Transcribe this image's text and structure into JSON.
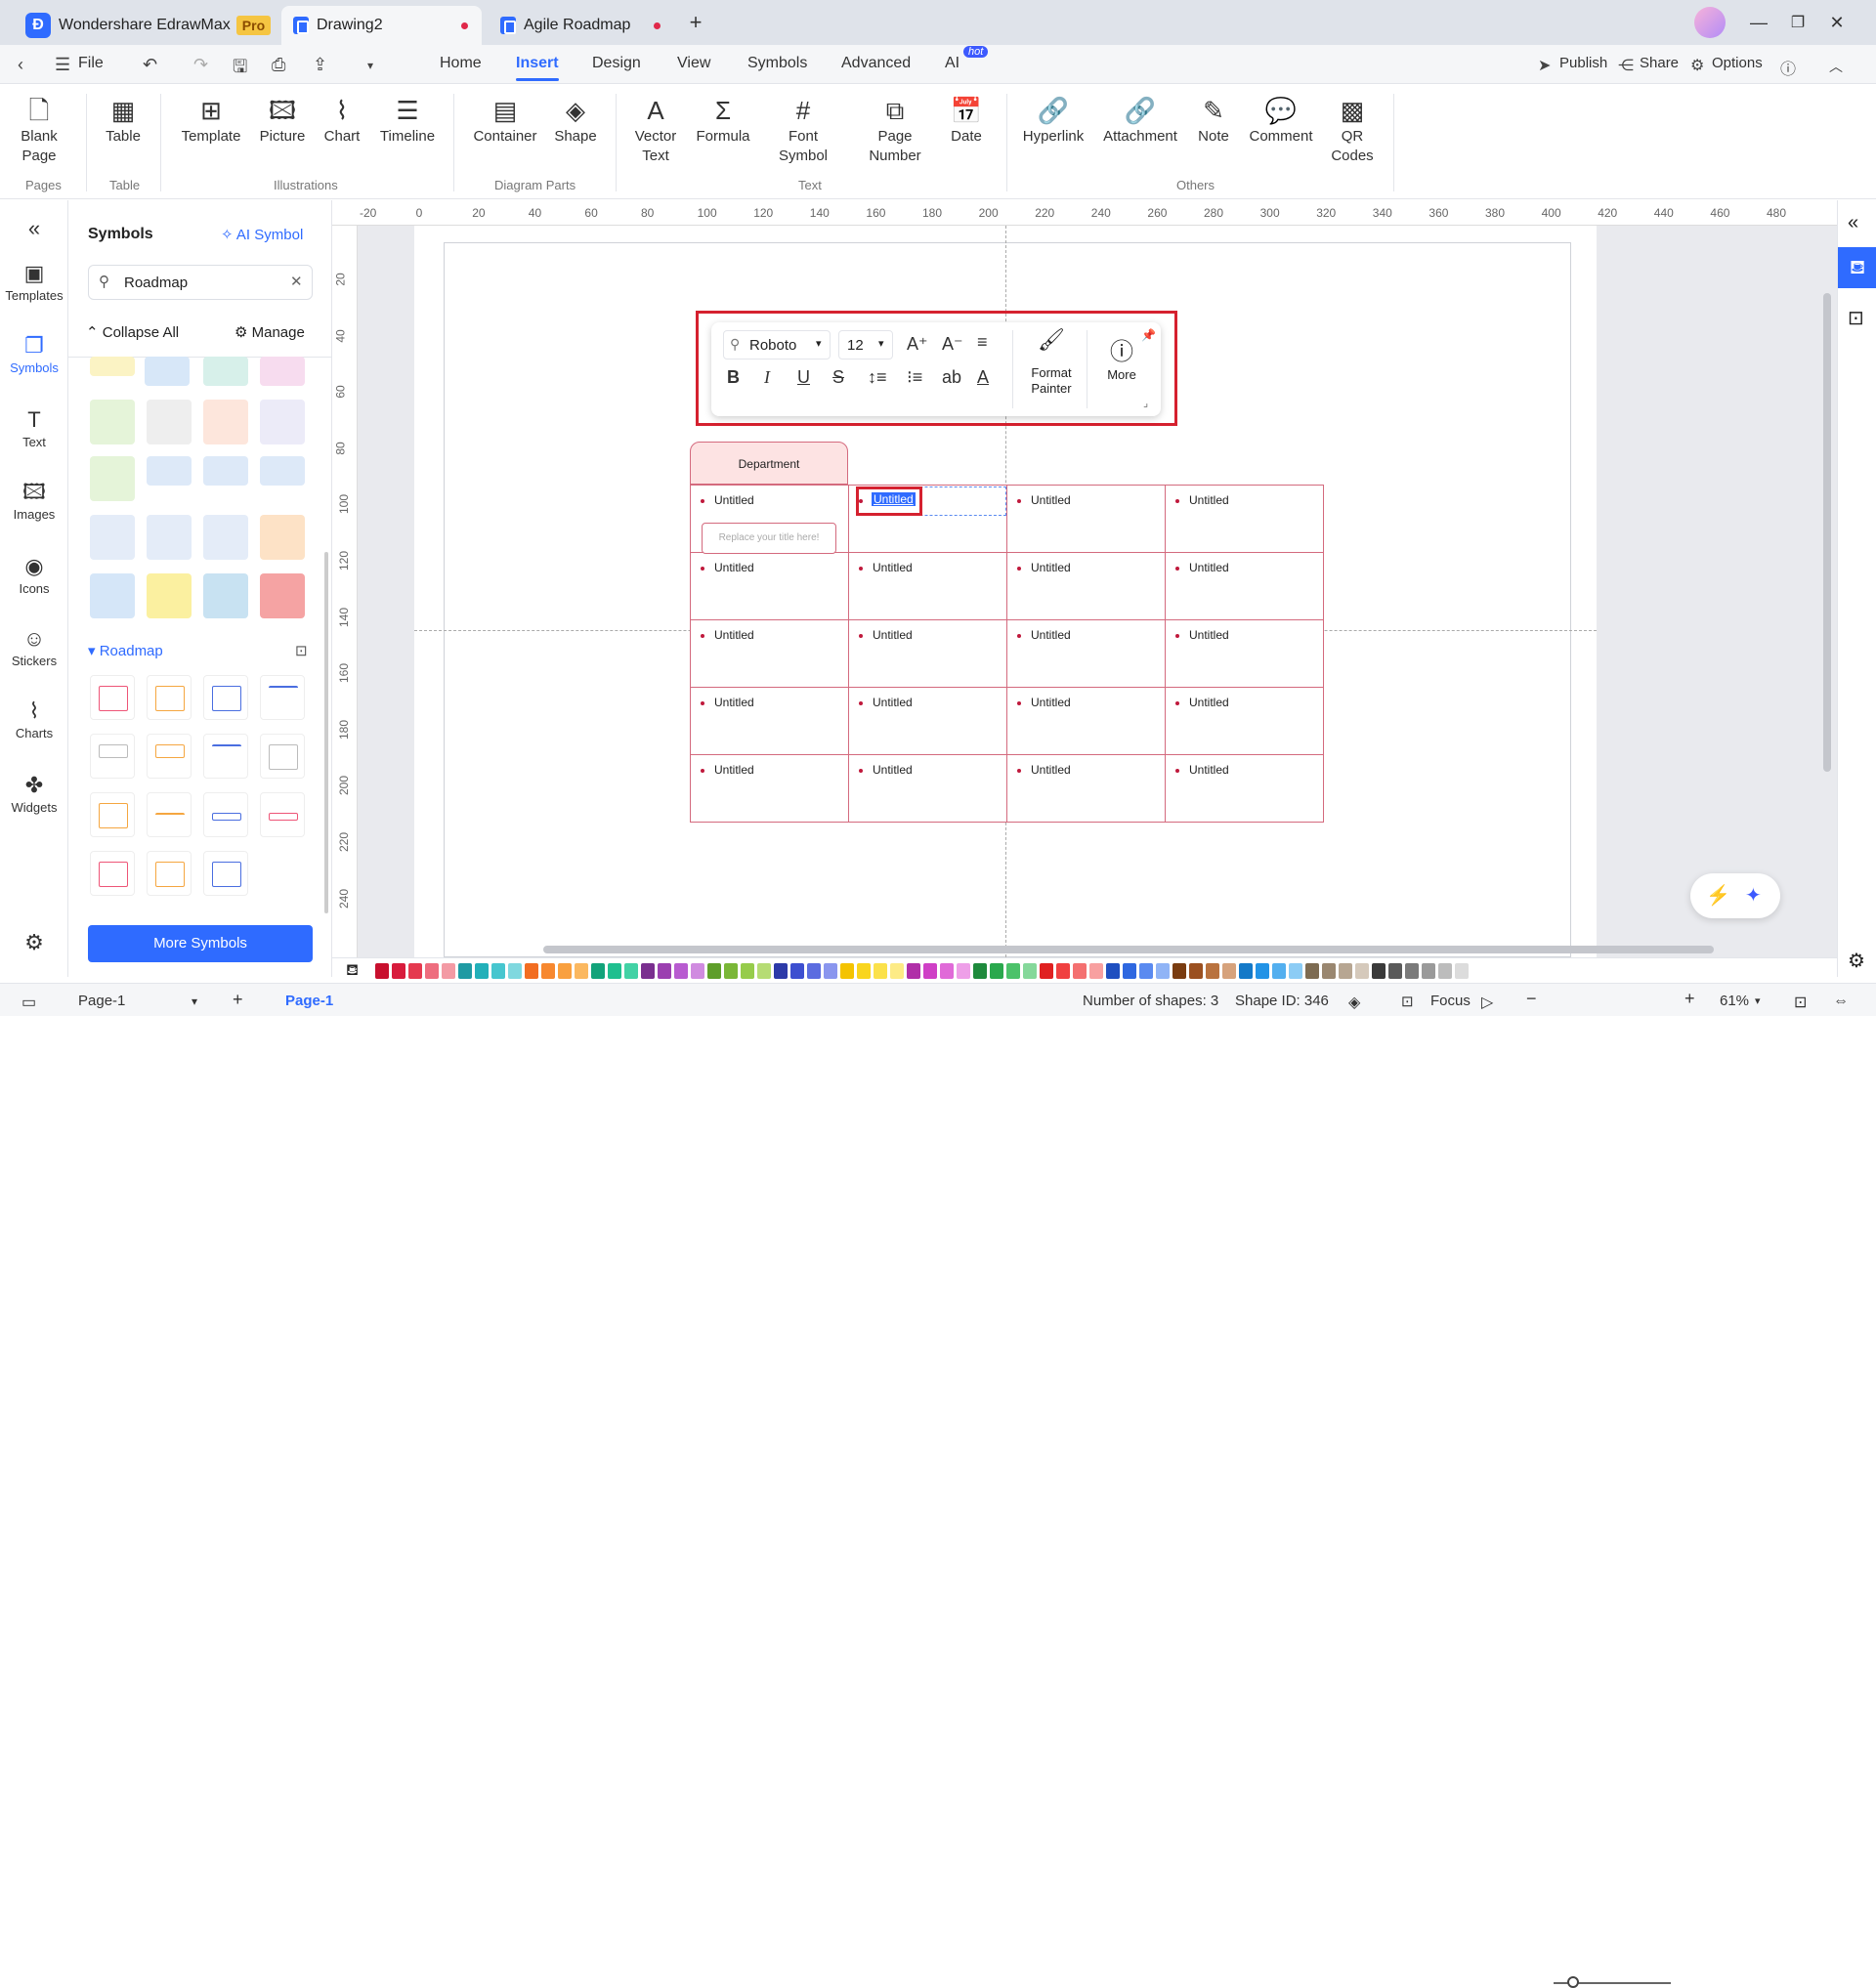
{
  "app": {
    "name": "Wondershare EdrawMax",
    "badge": "Pro"
  },
  "tabs": [
    {
      "label": "Drawing2"
    },
    {
      "label": "Agile Roadmap"
    }
  ],
  "menu": {
    "file": "File",
    "items": [
      "Home",
      "Insert",
      "Design",
      "View",
      "Symbols",
      "Advanced",
      "AI"
    ],
    "hot": "hot",
    "publish": "Publish",
    "share": "Share",
    "options": "Options"
  },
  "ribbon": {
    "buttons": {
      "blank_page": [
        "Blank",
        "Page"
      ],
      "table": "Table",
      "template": "Template",
      "picture": "Picture",
      "chart": "Chart",
      "timeline": "Timeline",
      "container": "Container",
      "shape": "Shape",
      "vector_text": [
        "Vector",
        "Text"
      ],
      "formula": "Formula",
      "font_symbol": [
        "Font",
        "Symbol"
      ],
      "page_number": [
        "Page",
        "Number"
      ],
      "date": "Date",
      "hyperlink": "Hyperlink",
      "attachment": "Attachment",
      "note": "Note",
      "comment": "Comment",
      "qr_codes": [
        "QR",
        "Codes"
      ]
    },
    "groups": {
      "pages": "Pages",
      "table": "Table",
      "illustrations": "Illustrations",
      "diagram_parts": "Diagram Parts",
      "text": "Text",
      "others": "Others"
    }
  },
  "rail": [
    "Templates",
    "Symbols",
    "Text",
    "Images",
    "Icons",
    "Stickers",
    "Charts",
    "Widgets"
  ],
  "panel": {
    "title": "Symbols",
    "ai_symbol": "AI Symbol",
    "search_value": "Roadmap",
    "collapse_all": "Collapse All",
    "manage": "Manage",
    "section": "Roadmap",
    "more_symbols": "More Symbols"
  },
  "rulers": {
    "h": [
      "-20",
      "0",
      "20",
      "40",
      "60",
      "80",
      "100",
      "120",
      "140",
      "160",
      "180",
      "200",
      "220",
      "240",
      "260",
      "280",
      "300",
      "320",
      "340",
      "360",
      "380",
      "400",
      "420",
      "440",
      "460",
      "480"
    ],
    "v": [
      "20",
      "40",
      "60",
      "80",
      "100",
      "120",
      "140",
      "160",
      "180",
      "200",
      "220",
      "240"
    ]
  },
  "toolbar": {
    "font": "Roboto",
    "size": "12",
    "format_painter": [
      "Format",
      "Painter"
    ],
    "more": "More"
  },
  "table": {
    "header": "Department",
    "cell_text": "Untitled",
    "placeholder": "Replace your title here!"
  },
  "colors": [
    "#c8102e",
    "#d81b3c",
    "#e5394f",
    "#ee6d7e",
    "#f39aa4",
    "#1f9aa3",
    "#22b0b9",
    "#46c6cf",
    "#7fd8df",
    "#f26d21",
    "#f7882f",
    "#f9a03f",
    "#fbb860",
    "#12a37a",
    "#1fbf8f",
    "#42d2a5",
    "#7a2f8f",
    "#9b3fb0",
    "#b85bd0",
    "#d08be0",
    "#5e9e2a",
    "#7ab737",
    "#96cc4b",
    "#b6dc74",
    "#2c3aa8",
    "#3d4fd0",
    "#5b6ce0",
    "#8a96ee",
    "#f4c300",
    "#f9d51e",
    "#fbe14a",
    "#fdeb86",
    "#b02fa8",
    "#cf3fc6",
    "#e06ad8",
    "#ee9fe8",
    "#1e8a3c",
    "#2aa84d",
    "#4cc26a",
    "#85d89a",
    "#e02020",
    "#f04040",
    "#f47070",
    "#f8a0a0",
    "#1f4fc0",
    "#2e67e0",
    "#5a8af0",
    "#90b4f6",
    "#7a3c10",
    "#9b5020",
    "#b9723e",
    "#d6a27c",
    "#1479c8",
    "#2293e6",
    "#53afef",
    "#8cccf5",
    "#7d6b52",
    "#9a8770",
    "#b7a692",
    "#d5c9bb",
    "#3a3a3a",
    "#5a5a5a",
    "#7a7a7a",
    "#9a9a9a",
    "#bcbcbc",
    "#dcdcdc"
  ],
  "status": {
    "page_select": "Page-1",
    "page_tab": "Page-1",
    "shapes": "Number of shapes: 3",
    "shape_id": "Shape ID: 346",
    "focus": "Focus",
    "zoom": "61%"
  }
}
